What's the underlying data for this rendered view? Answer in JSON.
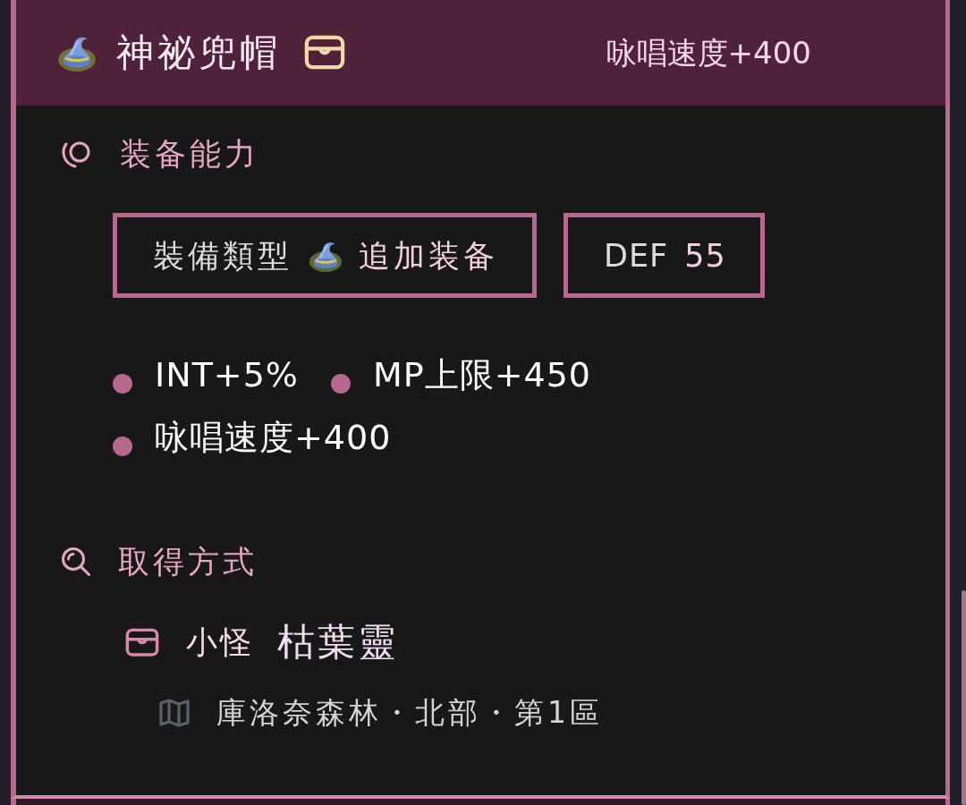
{
  "header": {
    "name": "神祕兜帽",
    "effect": "咏唱速度+400"
  },
  "sections": [
    {
      "kind": "ability",
      "title": "装备能力",
      "equip_type": {
        "label": "裝備類型",
        "value": "追加装备"
      },
      "defense": {
        "label": "DEF",
        "value": "55"
      },
      "stats": [
        "INT+5%",
        "MP上限+450",
        "咏唱速度+400"
      ]
    },
    {
      "kind": "source",
      "title": "取得方式",
      "sources": [
        {
          "category": "小怪",
          "name": "枯葉靈",
          "location": "庫洛奈森林・北部・第1區"
        }
      ]
    }
  ]
}
